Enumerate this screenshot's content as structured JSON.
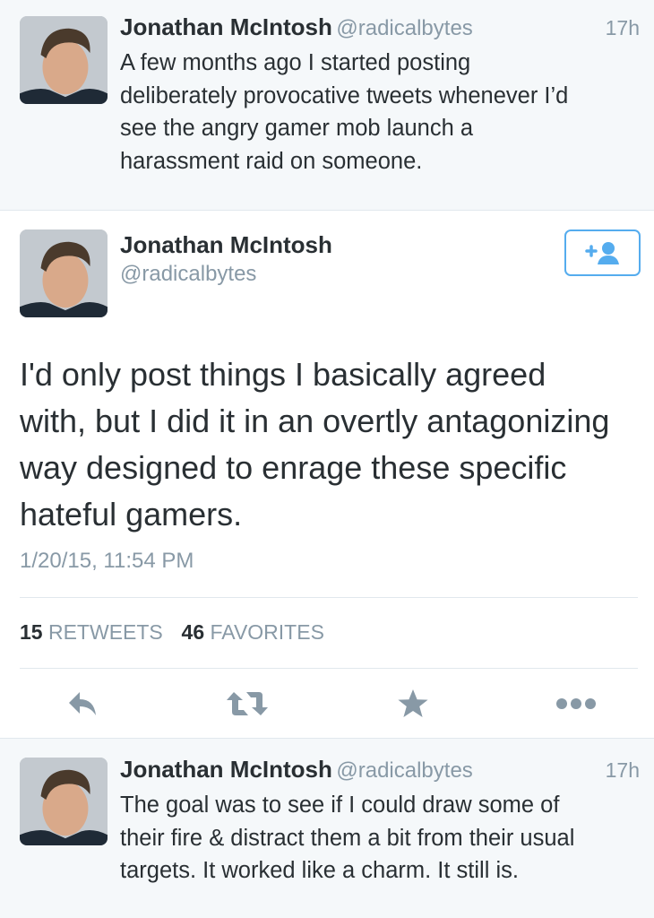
{
  "tweet1": {
    "name": "Jonathan McIntosh",
    "handle": "@radicalbytes",
    "time": "17h",
    "lines": [
      "A few months ago I started posting",
      "deliberately provocative tweets whenever I’d",
      "see the angry gamer mob launch a",
      "harassment raid on someone."
    ]
  },
  "detail": {
    "name": "Jonathan McIntosh",
    "handle": "@radicalbytes",
    "follow_icon": "follow-user-icon",
    "lines": [
      "I'd only post things I basically agreed",
      "with, but I did it in an overtly antagonizing",
      "way designed to enrage these specific",
      "hateful gamers."
    ],
    "timestamp": "1/20/15, 11:54 PM",
    "retweets_count": "15",
    "retweets_label": "RETWEETS",
    "favorites_count": "46",
    "favorites_label": "FAVORITES",
    "actions": [
      "reply-icon",
      "retweet-icon",
      "favorite-icon",
      "more-icon"
    ],
    "icon_color": "#8899a6",
    "accent": "#55acee"
  },
  "tweet3": {
    "name": "Jonathan McIntosh",
    "handle": "@radicalbytes",
    "time": "17h",
    "lines": [
      "The goal was to see if I could draw some of",
      "their fire & distract them a bit from their usual",
      "targets. It worked like a charm. It still is."
    ]
  }
}
